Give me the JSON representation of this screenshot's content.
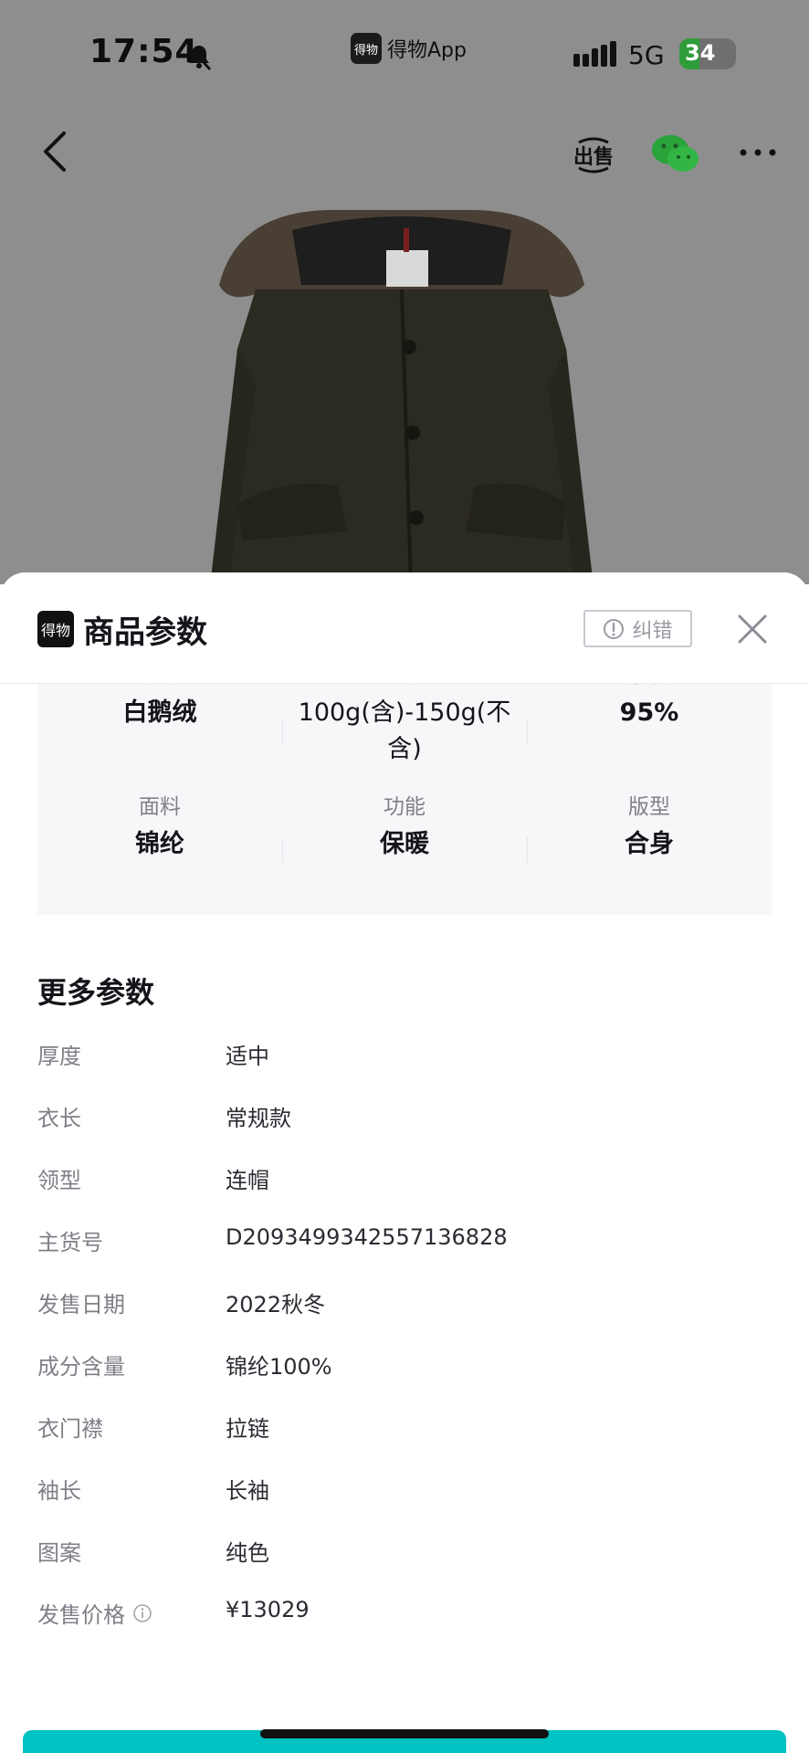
{
  "status_bar": {
    "time": "17:54",
    "app_name": "得物App",
    "network": "5G",
    "battery": "34"
  },
  "nav": {
    "sell_label": "出售",
    "icons": [
      "back-arrow-icon",
      "sell-icon",
      "wechat-icon",
      "more-icon"
    ]
  },
  "sheet": {
    "logo_text": "得物",
    "title": "商品参数",
    "report_label": "纠错",
    "key_params": [
      {
        "label": "填充物",
        "value": "白鹅绒"
      },
      {
        "label": "充绒量",
        "value": "100g(含)-150g(不含)"
      },
      {
        "label": "绒子含量",
        "value": "95%"
      },
      {
        "label": "面料",
        "value": "锦纶"
      },
      {
        "label": "功能",
        "value": "保暖"
      },
      {
        "label": "版型",
        "value": "合身"
      }
    ],
    "more_title": "更多参数",
    "more_params": [
      {
        "label": "厚度",
        "value": "适中"
      },
      {
        "label": "衣长",
        "value": "常规款"
      },
      {
        "label": "领型",
        "value": "连帽"
      },
      {
        "label": "主货号",
        "value": "D2093499342557136828"
      },
      {
        "label": "发售日期",
        "value": "2022秋冬"
      },
      {
        "label": "成分含量",
        "value": "锦纶100%"
      },
      {
        "label": "衣门襟",
        "value": "拉链"
      },
      {
        "label": "袖长",
        "value": "长袖"
      },
      {
        "label": "图案",
        "value": "纯色"
      },
      {
        "label": "发售价格",
        "value": "¥13029"
      }
    ]
  },
  "colors": {
    "overlay": "#8e8e8e",
    "accent": "#01c2c3",
    "text_primary": "#14151a",
    "text_secondary": "#7f7f88"
  }
}
